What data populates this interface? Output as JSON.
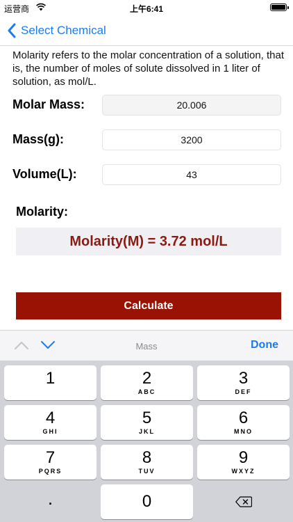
{
  "status_bar": {
    "carrier": "运营商",
    "time": "上午6:41"
  },
  "nav": {
    "back_label": "Select Chemical"
  },
  "description": "Molarity refers to the molar concentration of a solution, that is, the number of moles of solute dissolved in 1 liter of solution, as mol/L.",
  "form": {
    "molar_mass_label": "Molar Mass:",
    "molar_mass_value": "20.006",
    "mass_label": "Mass(g):",
    "mass_value": "3200",
    "volume_label": "Volume(L):",
    "volume_value": "43"
  },
  "result": {
    "label": "Molarity:",
    "value": "Molarity(M) = 3.72 mol/L"
  },
  "calculate_label": "Calculate",
  "accessory": {
    "field_title": "Mass",
    "done_label": "Done"
  },
  "keypad": {
    "keys": [
      {
        "num": "1",
        "letters": ""
      },
      {
        "num": "2",
        "letters": "ABC"
      },
      {
        "num": "3",
        "letters": "DEF"
      },
      {
        "num": "4",
        "letters": "GHI"
      },
      {
        "num": "5",
        "letters": "JKL"
      },
      {
        "num": "6",
        "letters": "MNO"
      },
      {
        "num": "7",
        "letters": "PQRS"
      },
      {
        "num": "8",
        "letters": "TUV"
      },
      {
        "num": "9",
        "letters": "WXYZ"
      }
    ],
    "dot": ".",
    "zero": "0"
  },
  "icons": {
    "back": "chevron-left-icon",
    "wifi": "wifi-icon",
    "battery": "battery-icon",
    "up": "chevron-up-icon",
    "down": "chevron-down-icon",
    "delete": "backspace-icon"
  },
  "colors": {
    "accent": "#1a7cf5",
    "result_text": "#8c1a10",
    "button": "#9a1203"
  }
}
